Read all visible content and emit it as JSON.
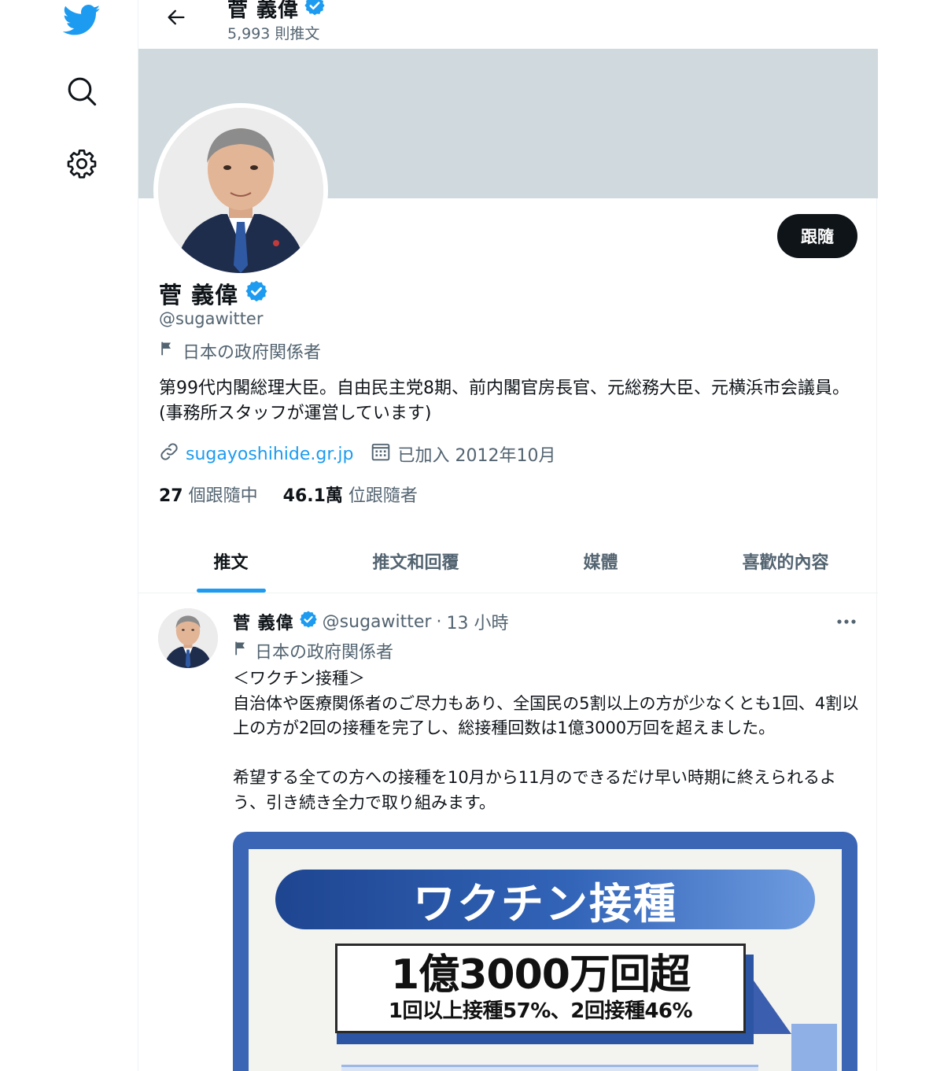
{
  "nav": {
    "logo_color": "#1d9bf0"
  },
  "header": {
    "title": "菅 義偉",
    "subtitle": "5,993 則推文"
  },
  "profile": {
    "follow_label": "跟隨",
    "name": "菅 義偉",
    "handle": "@sugawitter",
    "affiliation": "日本の政府関係者",
    "bio": "第99代内閣総理大臣。自由民主党8期、前内閣官房長官、元総務大臣、元横浜市会議員。(事務所スタッフが運営しています)",
    "website": "sugayoshihide.gr.jp",
    "joined": "已加入 2012年10月",
    "following_count": "27",
    "following_label": "個跟隨中",
    "followers_count": "46.1萬",
    "followers_label": "位跟隨者"
  },
  "tabs": [
    {
      "label": "推文",
      "active": true
    },
    {
      "label": "推文和回覆",
      "active": false
    },
    {
      "label": "媒體",
      "active": false
    },
    {
      "label": "喜歡的內容",
      "active": false
    }
  ],
  "tweet": {
    "name": "菅 義偉",
    "handle": "@sugawitter",
    "separator": "·",
    "time": "13 小時",
    "affiliation": "日本の政府関係者",
    "lines": [
      "＜ワクチン接種＞",
      "自治体や医療関係者のご尽力もあり、全国民の5割以上の方が少なくとも1回、4割以上の方が2回の接種を完了し、総接種回数は1億3000万回を超えました。",
      "",
      "希望する全ての方への接種を10月から11月のできるだけ早い時期に終えられるよう、引き続き全力で取り組みます。"
    ],
    "image": {
      "title": "ワクチン接種",
      "big_stat": "1億3000万回超",
      "sub_stat": "1回以上接種57%、2回接種46%"
    }
  },
  "colors": {
    "accent": "#1d9bf0",
    "text": "#0f1419",
    "muted": "#536471",
    "banner": "#cfd9de"
  }
}
